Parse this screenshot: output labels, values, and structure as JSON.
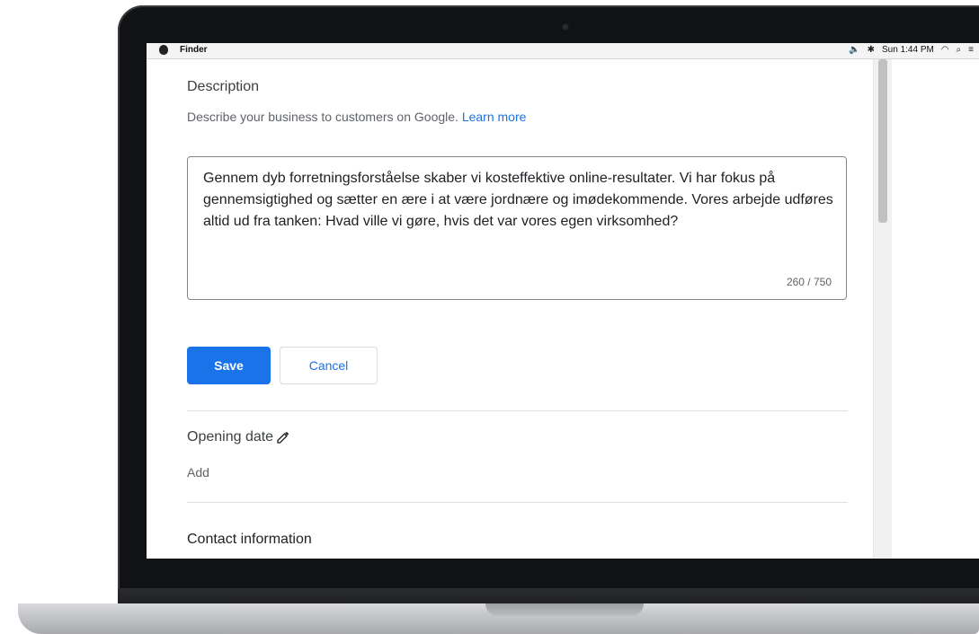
{
  "menubar": {
    "app_name": "Finder",
    "clock": "Sun 1:44 PM"
  },
  "description": {
    "title": "Description",
    "help_text": "Describe your business to customers on Google.",
    "learn_more": "Learn more",
    "text": "Gennem dyb forretningsforståelse skaber vi kosteffektive online-resultater. Vi har fokus på gennemsigtighed og sætter en ære i at være jordnære og imødekommende. Vores arbejde udføres altid ud fra tanken: Hvad ville vi gøre, hvis det var vores egen virksomhed?",
    "counter": "260 / 750"
  },
  "buttons": {
    "save": "Save",
    "cancel": "Cancel"
  },
  "opening_date": {
    "title": "Opening date",
    "value": "Add"
  },
  "contact": {
    "title": "Contact information"
  },
  "colors": {
    "primary": "#1a73e8",
    "text": "#202124",
    "muted": "#5f6368"
  }
}
